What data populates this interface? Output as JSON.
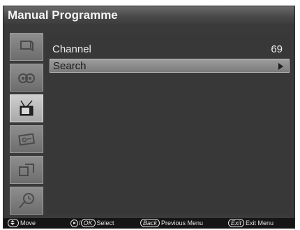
{
  "window": {
    "title": "Manual Programme"
  },
  "sidebar": {
    "items": [
      {
        "icon": "picture-icon"
      },
      {
        "icon": "sound-icon"
      },
      {
        "icon": "tv-antenna-icon",
        "active": true
      },
      {
        "icon": "settings-card-icon"
      },
      {
        "icon": "screens-icon"
      },
      {
        "icon": "clock-icon"
      }
    ]
  },
  "menu": {
    "rows": [
      {
        "label": "Channel",
        "value": "69"
      },
      {
        "label": "Search",
        "selected": true
      }
    ]
  },
  "footer": {
    "move_label": "Move",
    "select_sep": "/",
    "ok_key": "OK",
    "select_label": "Select",
    "back_key": "Back",
    "back_label": "Previous Menu",
    "exit_key": "Exit",
    "exit_label": "Exit Menu"
  }
}
